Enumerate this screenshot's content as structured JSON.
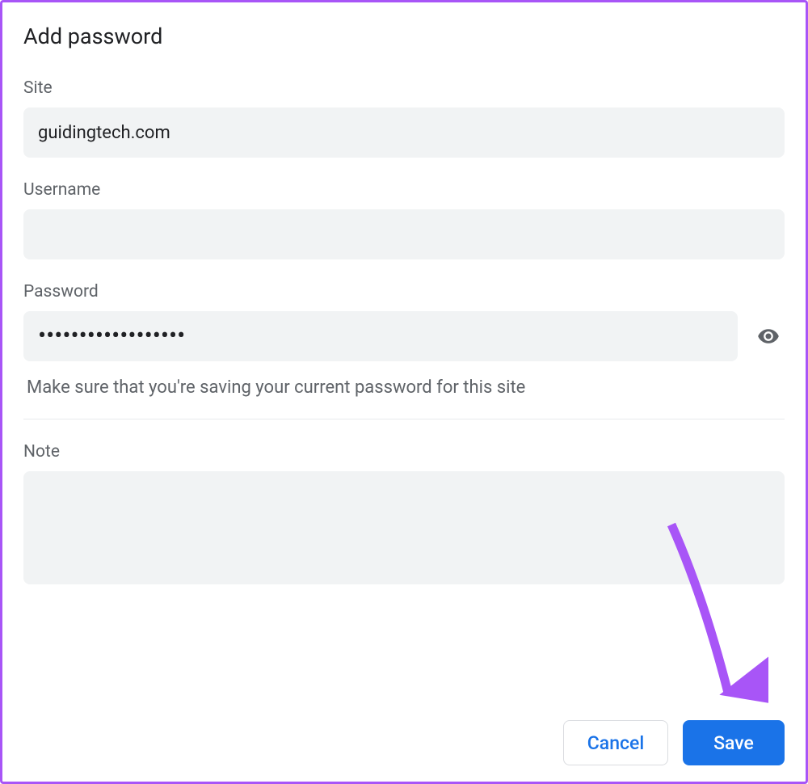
{
  "dialog": {
    "title": "Add password",
    "fields": {
      "site": {
        "label": "Site",
        "value": "guidingtech.com"
      },
      "username": {
        "label": "Username",
        "value": ""
      },
      "password": {
        "label": "Password",
        "value": "••••••••••••••••••",
        "helper": "Make sure that you're saving your current password for this site"
      },
      "note": {
        "label": "Note",
        "value": ""
      }
    },
    "buttons": {
      "cancel": "Cancel",
      "save": "Save"
    }
  }
}
